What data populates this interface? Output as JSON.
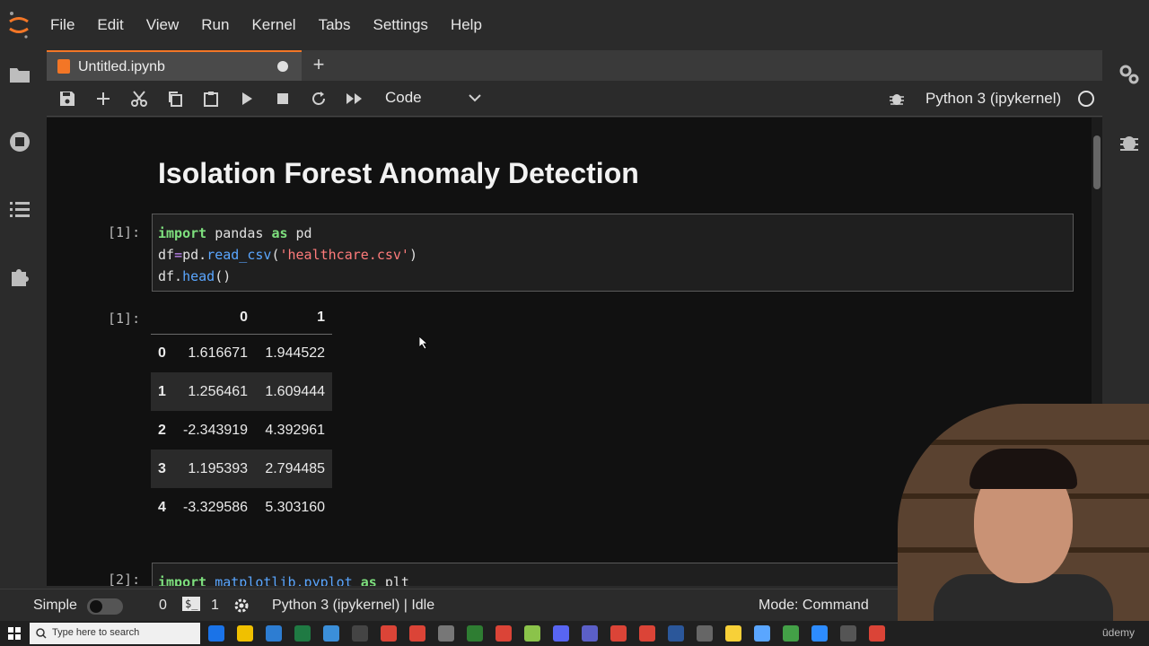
{
  "menubar": {
    "items": [
      "File",
      "Edit",
      "View",
      "Run",
      "Kernel",
      "Tabs",
      "Settings",
      "Help"
    ]
  },
  "tab": {
    "title": "Untitled.ipynb",
    "new_tab": "+"
  },
  "toolbar": {
    "cell_type": "Code",
    "kernel_name": "Python 3 (ipykernel)"
  },
  "notebook": {
    "heading": "Isolation Forest Anomaly Detection",
    "cell1": {
      "prompt": "[1]:",
      "line2_a": "df",
      "line2_b": "=",
      "line2_c": "pd.",
      "line2_d": "read_csv",
      "line2_e": "(",
      "line2_f": "'healthcare.csv'",
      "line2_g": ")",
      "line3_a": "df.",
      "line3_b": "head",
      "line3_c": "()"
    },
    "output1": {
      "prompt": "[1]:",
      "columns": [
        "0",
        "1"
      ],
      "rows": [
        {
          "index": "0",
          "c0": "1.616671",
          "c1": "1.944522"
        },
        {
          "index": "1",
          "c0": "1.256461",
          "c1": "1.609444"
        },
        {
          "index": "2",
          "c0": "-2.343919",
          "c1": "4.392961"
        },
        {
          "index": "3",
          "c0": "1.195393",
          "c1": "2.794485"
        },
        {
          "index": "4",
          "c0": "-3.329586",
          "c1": "5.303160"
        }
      ]
    },
    "cell2": {
      "prompt": "[2]:",
      "kw_import": "import",
      "module": "matplotlib.pyplot",
      "kw_as": "as",
      "alias": "plt"
    }
  },
  "statusbar": {
    "mode_simple": "Simple",
    "count_a": "0",
    "terminal_label": "$_",
    "count_b": "1",
    "kernel_status": "Python 3 (ipykernel) | Idle",
    "mode": "Mode: Command"
  },
  "taskbar": {
    "search_placeholder": "Type here to search"
  },
  "watermark": "ūdemy",
  "colors": {
    "accent": "#f37626",
    "keyword": "#7ee07e",
    "function": "#5aa6ff",
    "string": "#ff7b7b"
  }
}
